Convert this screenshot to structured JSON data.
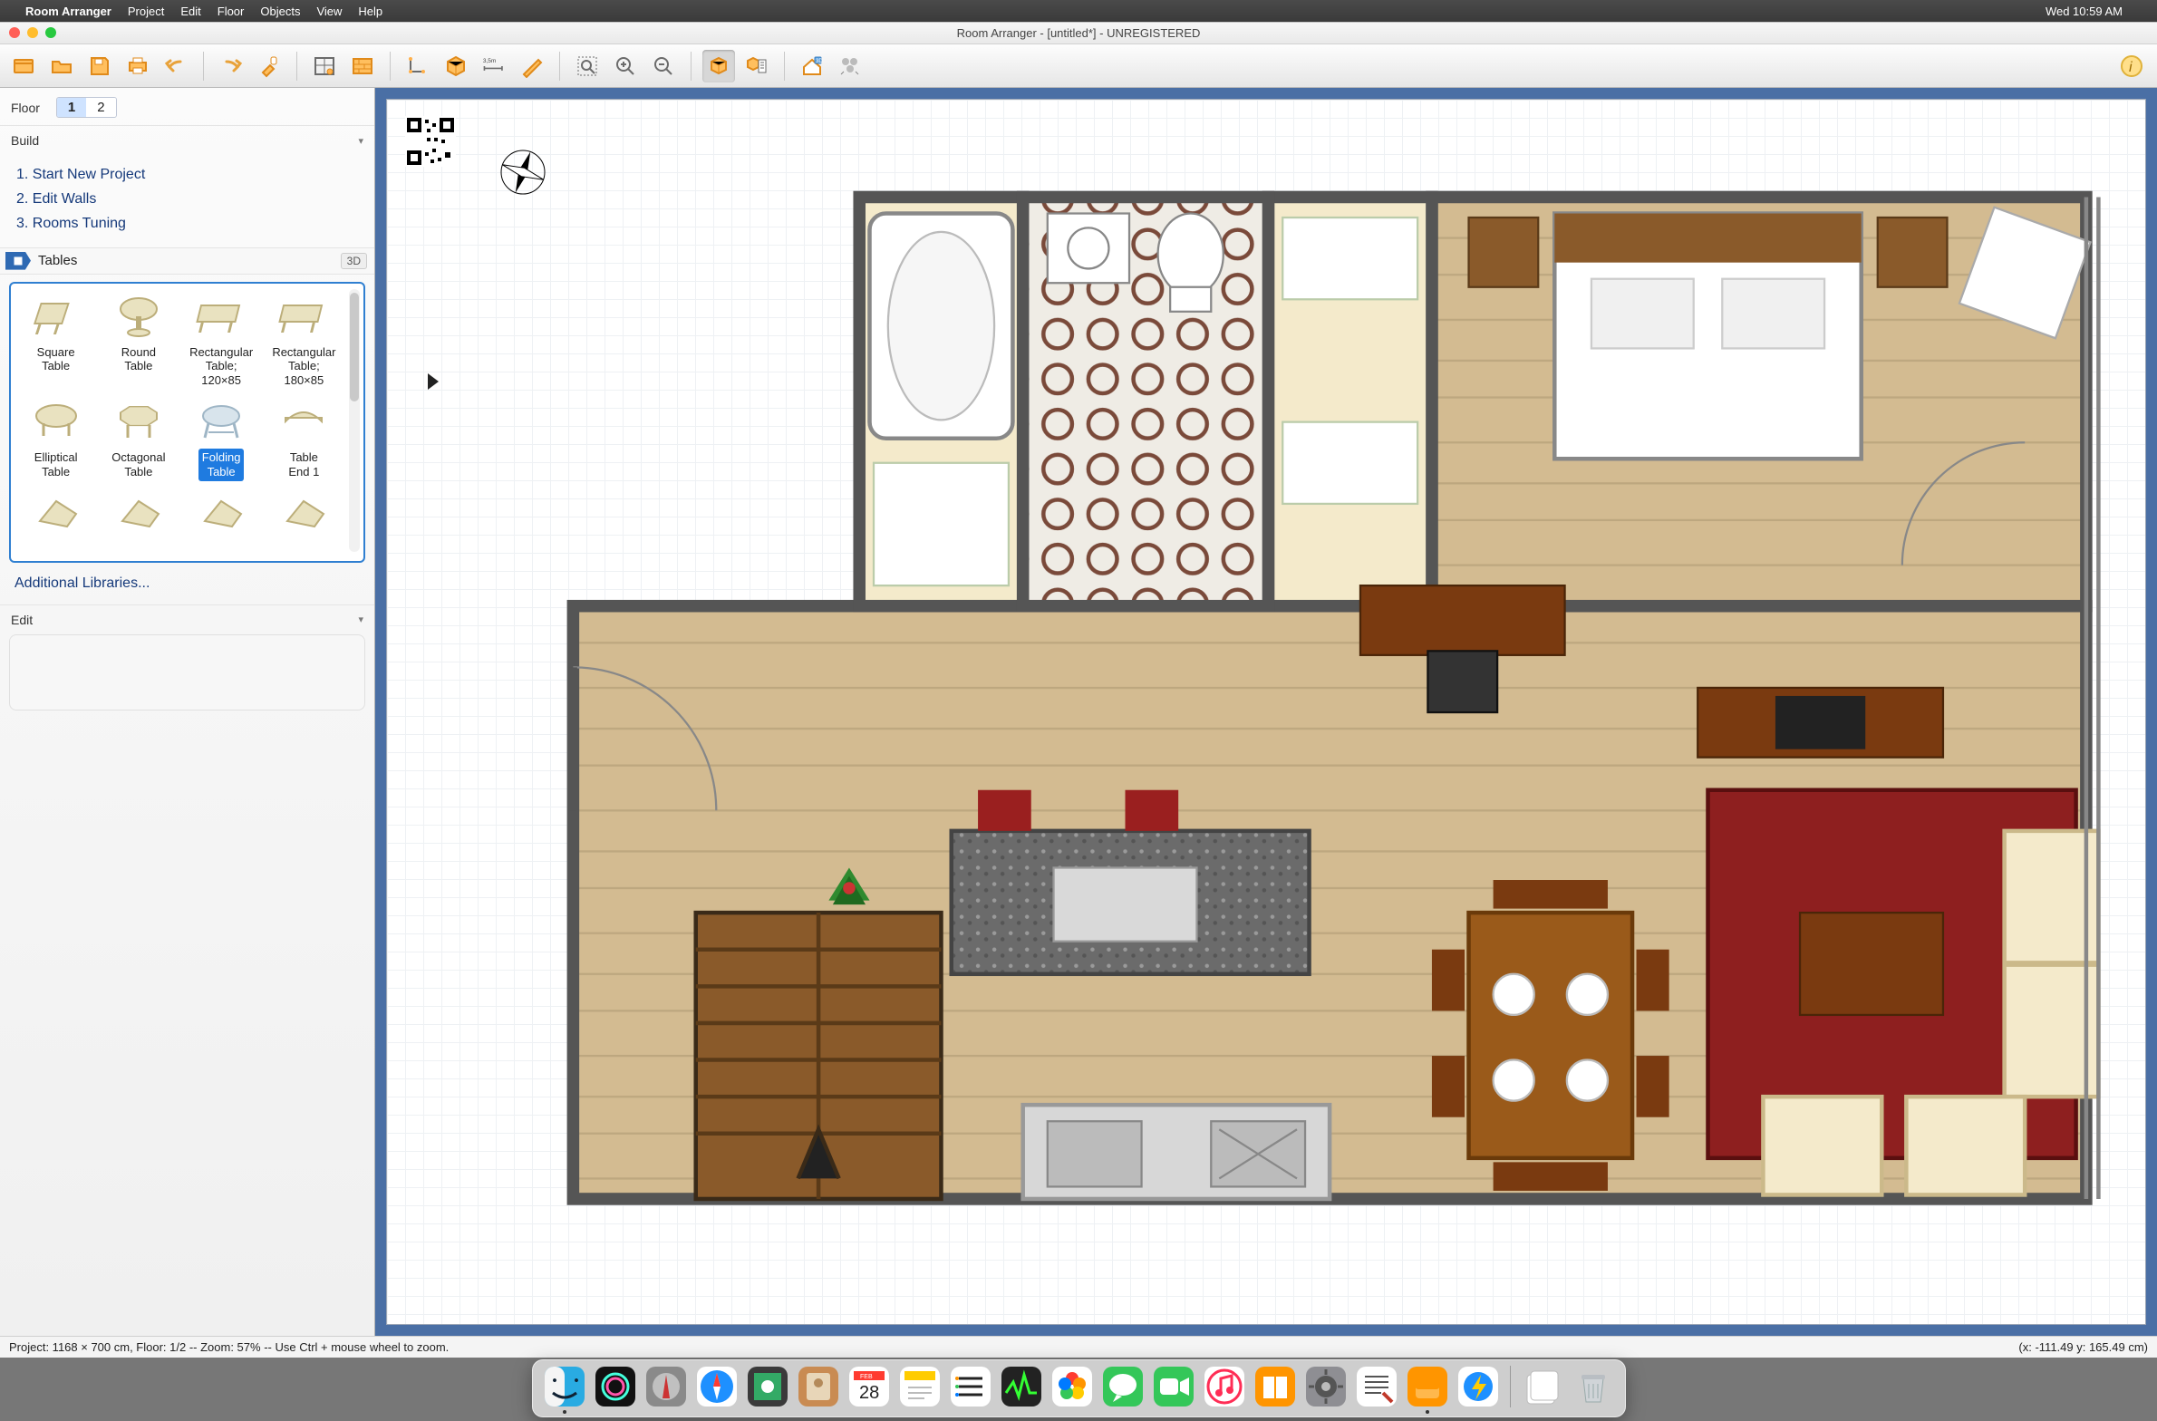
{
  "menubar": {
    "apple": "",
    "app": "Room Arranger",
    "items": [
      "Project",
      "Edit",
      "Floor",
      "Objects",
      "View",
      "Help"
    ],
    "clock": "Wed 10:59 AM"
  },
  "window": {
    "title": "Room Arranger - [untitled*] - UNREGISTERED"
  },
  "toolbar_names": {
    "new": "new-project",
    "open": "open",
    "save": "save",
    "print": "print",
    "undo": "undo",
    "redo": "redo",
    "paint": "paint",
    "wall_tool": "wall-designer",
    "wall_pattern": "wall-pattern",
    "room": "room-tool",
    "box": "box-object",
    "measure": "measurement",
    "pencil": "draw-line",
    "zoom_fit": "zoom-fit",
    "zoom_in": "zoom-in",
    "zoom_out": "zoom-out",
    "view3d_obj": "view-3d-object",
    "view3d_list": "object-list",
    "house3d": "view-3d",
    "effects": "effects",
    "info": "info"
  },
  "sidebar": {
    "floor_label": "Floor",
    "floors": [
      "1",
      "2"
    ],
    "floor_selected": 0,
    "build_title": "Build",
    "build_items": [
      "1. Start New Project",
      "2. Edit Walls",
      "3. Rooms Tuning"
    ],
    "category_label": "Tables",
    "badge_3d": "3D",
    "additional_libraries": "Additional Libraries...",
    "edit_title": "Edit",
    "gallery": [
      {
        "label": "Square\nTable",
        "shape": "square"
      },
      {
        "label": "Round\nTable",
        "shape": "round"
      },
      {
        "label": "Rectangular\nTable;\n120×85",
        "shape": "rect"
      },
      {
        "label": "Rectangular\nTable;\n180×85",
        "shape": "rect"
      },
      {
        "label": "Elliptical\nTable",
        "shape": "ellipse"
      },
      {
        "label": "Octagonal\nTable",
        "shape": "octagon"
      },
      {
        "label": "Folding\nTable",
        "shape": "fold",
        "selected": true
      },
      {
        "label": "Table\nEnd 1",
        "shape": "end"
      },
      {
        "label": "",
        "shape": "misc"
      },
      {
        "label": "",
        "shape": "misc"
      },
      {
        "label": "",
        "shape": "misc"
      },
      {
        "label": "",
        "shape": "misc"
      }
    ]
  },
  "canvas": {
    "measure_tag": "3,5 m"
  },
  "status": {
    "left": "Project: 1168 × 700 cm, Floor: 1/2 -- Zoom: 57% -- Use Ctrl + mouse wheel to zoom.",
    "right": "(x: -111.49 y: 165.49 cm)"
  },
  "dock": {
    "icons": [
      {
        "name": "finder",
        "running": true
      },
      {
        "name": "siri"
      },
      {
        "name": "launchpad"
      },
      {
        "name": "safari"
      },
      {
        "name": "preview"
      },
      {
        "name": "contacts"
      },
      {
        "name": "calendar",
        "badge": "28",
        "sub": "FEB"
      },
      {
        "name": "notes"
      },
      {
        "name": "reminders"
      },
      {
        "name": "activity-monitor"
      },
      {
        "name": "photos"
      },
      {
        "name": "messages"
      },
      {
        "name": "facetime"
      },
      {
        "name": "itunes"
      },
      {
        "name": "ibooks"
      },
      {
        "name": "system-preferences"
      },
      {
        "name": "textedit"
      },
      {
        "name": "room-arranger",
        "running": true
      },
      {
        "name": "bolt-app"
      },
      {
        "name": "sep"
      },
      {
        "name": "documents-stack"
      },
      {
        "name": "trash"
      }
    ]
  }
}
